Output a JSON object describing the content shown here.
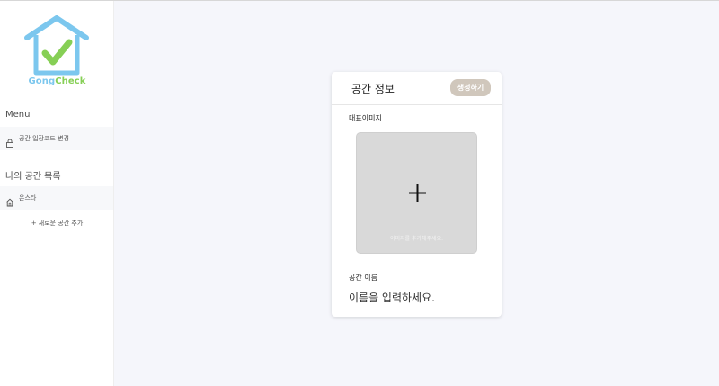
{
  "brand": {
    "name_part1": "Gong",
    "name_part2": "Check",
    "colors": {
      "house": "#7cc7ee",
      "check": "#86cf55"
    }
  },
  "sidebar": {
    "menu_label": "Menu",
    "menu_items": [
      {
        "icon": "lock-icon",
        "label": "공간 입장코드 변경"
      }
    ],
    "spaces_label": "나의 공간 목록",
    "spaces": [
      {
        "icon": "home-icon",
        "label": "온스타"
      }
    ],
    "add_space_label": "+ 새로운 공간 추가"
  },
  "card": {
    "title": "공간 정보",
    "create_button": "생성하기",
    "image_label": "대표이미지",
    "image_hint": "이미지를 추가해주세요.",
    "name_label": "공간 이름",
    "name_placeholder": "이름을 입력하세요."
  },
  "colors": {
    "background": "#f5f6fb",
    "button": "#d0c7bc",
    "image_box": "#d9d9d9"
  }
}
